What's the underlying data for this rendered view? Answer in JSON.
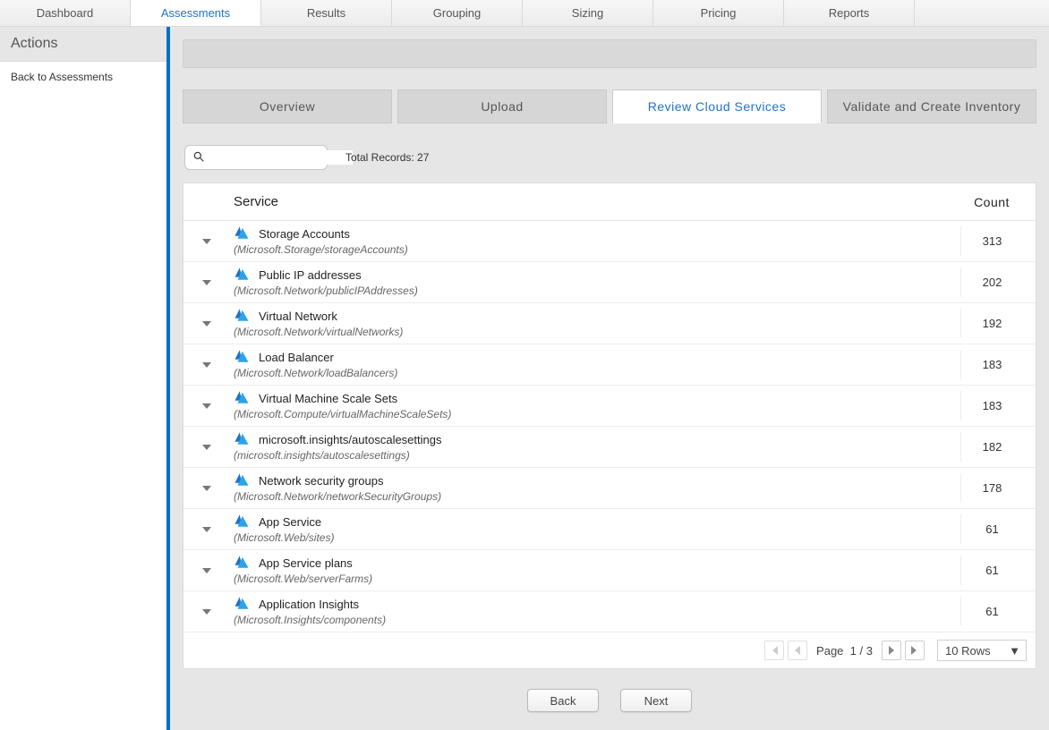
{
  "topnav": {
    "tabs": [
      {
        "label": "Dashboard"
      },
      {
        "label": "Assessments"
      },
      {
        "label": "Results"
      },
      {
        "label": "Grouping"
      },
      {
        "label": "Sizing"
      },
      {
        "label": "Pricing"
      },
      {
        "label": "Reports"
      }
    ],
    "active_index": 1
  },
  "sidebar": {
    "title": "Actions",
    "back_link": "Back to Assessments"
  },
  "inner_tabs": {
    "items": [
      {
        "label": "Overview"
      },
      {
        "label": "Upload"
      },
      {
        "label": "Review Cloud Services"
      },
      {
        "label": "Validate and Create Inventory"
      }
    ],
    "active_index": 2
  },
  "search": {
    "placeholder": ""
  },
  "total_records_label": "Total Records: 27",
  "table": {
    "headers": {
      "service": "Service",
      "count": "Count"
    },
    "rows": [
      {
        "name": "Storage Accounts",
        "sub": "(Microsoft.Storage/storageAccounts)",
        "count": "313"
      },
      {
        "name": "Public IP addresses",
        "sub": "(Microsoft.Network/publicIPAddresses)",
        "count": "202"
      },
      {
        "name": "Virtual Network",
        "sub": "(Microsoft.Network/virtualNetworks)",
        "count": "192"
      },
      {
        "name": "Load Balancer",
        "sub": "(Microsoft.Network/loadBalancers)",
        "count": "183"
      },
      {
        "name": "Virtual Machine Scale Sets",
        "sub": "(Microsoft.Compute/virtualMachineScaleSets)",
        "count": "183"
      },
      {
        "name": "microsoft.insights/autoscalesettings",
        "sub": "(microsoft.insights/autoscalesettings)",
        "count": "182"
      },
      {
        "name": "Network security groups",
        "sub": "(Microsoft.Network/networkSecurityGroups)",
        "count": "178"
      },
      {
        "name": "App Service",
        "sub": "(Microsoft.Web/sites)",
        "count": "61"
      },
      {
        "name": "App Service plans",
        "sub": "(Microsoft.Web/serverFarms)",
        "count": "61"
      },
      {
        "name": "Application Insights",
        "sub": "(Microsoft.Insights/components)",
        "count": "61"
      }
    ]
  },
  "pager": {
    "page_label": "Page",
    "current": "1",
    "sep": "/",
    "total": "3",
    "rows_label": "10 Rows"
  },
  "buttons": {
    "back": "Back",
    "next": "Next"
  }
}
